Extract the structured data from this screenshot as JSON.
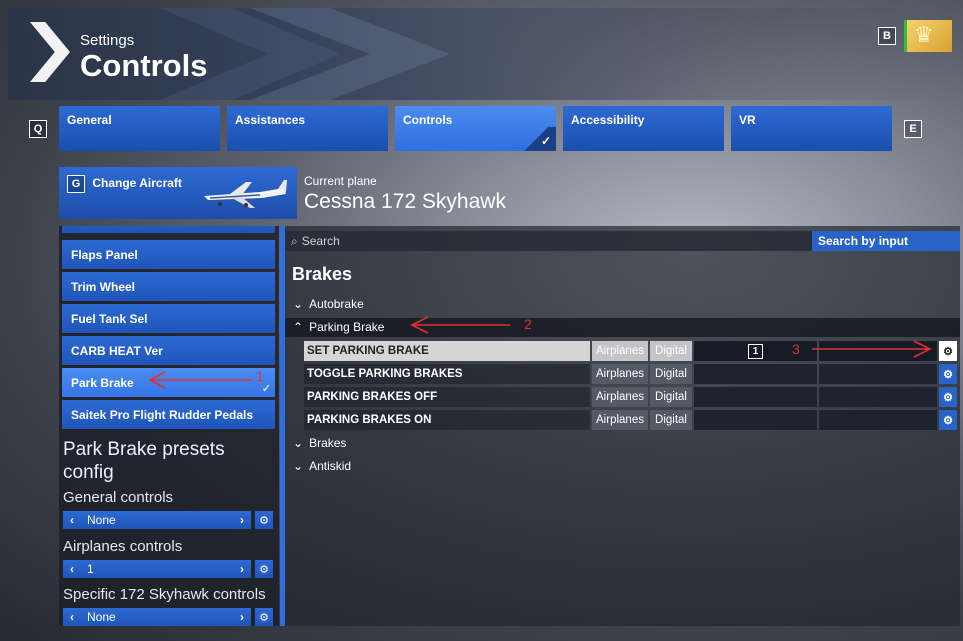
{
  "header": {
    "subtitle": "Settings",
    "title": "Controls"
  },
  "keys": {
    "left": "Q",
    "right": "E",
    "back": "B",
    "change": "G"
  },
  "tabs": [
    {
      "label": "General"
    },
    {
      "label": "Assistances"
    },
    {
      "label": "Controls",
      "active": true
    },
    {
      "label": "Accessibility"
    },
    {
      "label": "VR"
    }
  ],
  "aircraft": {
    "change_label": "Change Aircraft",
    "current_label": "Current plane",
    "current_name": "Cessna 172 Skyhawk"
  },
  "devices": [
    {
      "label": "Flaps Panel"
    },
    {
      "label": "Trim Wheel"
    },
    {
      "label": "Fuel Tank Sel"
    },
    {
      "label": "CARB HEAT Ver"
    },
    {
      "label": "Park Brake",
      "active": true
    },
    {
      "label": "Saitek Pro Flight Rudder Pedals"
    }
  ],
  "presets": {
    "title": "Park Brake presets config",
    "general": {
      "label": "General controls",
      "value": "None"
    },
    "airplanes": {
      "label": "Airplanes controls",
      "value": "1"
    },
    "specific": {
      "label": "Specific 172 Skyhawk controls",
      "value": "None"
    }
  },
  "search": {
    "placeholder": "Search",
    "by_input": "Search by input"
  },
  "section_title": "Brakes",
  "groups": {
    "autobrake": "Autobrake",
    "parking": "Parking Brake",
    "brakes": "Brakes",
    "antiskid": "Antiskid"
  },
  "bindings": [
    {
      "name": "SET PARKING BRAKE",
      "category": "Airplanes",
      "type": "Digital",
      "input1": "1",
      "selected": true
    },
    {
      "name": "TOGGLE PARKING BRAKES",
      "category": "Airplanes",
      "type": "Digital",
      "input1": ""
    },
    {
      "name": "PARKING BRAKES OFF",
      "category": "Airplanes",
      "type": "Digital",
      "input1": ""
    },
    {
      "name": "PARKING BRAKES ON",
      "category": "Airplanes",
      "type": "Digital",
      "input1": ""
    }
  ],
  "annotations": {
    "a1": "1",
    "a2": "2",
    "a3": "3"
  },
  "colors": {
    "accent": "#2f6fe0",
    "annotation": "#e03030"
  }
}
